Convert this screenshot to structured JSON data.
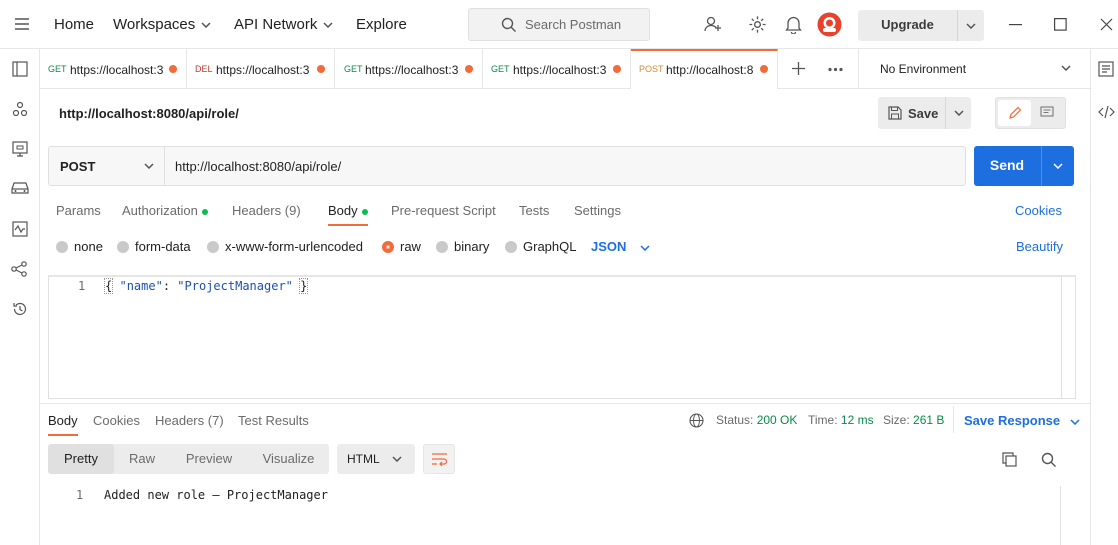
{
  "topbar": {
    "home": "Home",
    "workspaces": "Workspaces",
    "api_network": "API Network",
    "explore": "Explore",
    "search_placeholder": "Search Postman",
    "upgrade": "Upgrade"
  },
  "tabs": [
    {
      "method": "GET",
      "url": "https://localhost:3"
    },
    {
      "method": "DEL",
      "url": "https://localhost:3"
    },
    {
      "method": "GET",
      "url": "https://localhost:3"
    },
    {
      "method": "GET",
      "url": "https://localhost:3"
    },
    {
      "method": "POST",
      "url": "http://localhost:8"
    }
  ],
  "environment": "No Environment",
  "request": {
    "title": "http://localhost:8080/api/role/",
    "save_label": "Save",
    "method": "POST",
    "url": "http://localhost:8080/api/role/",
    "send_label": "Send"
  },
  "request_tabs": {
    "params": "Params",
    "authorization": "Authorization",
    "headers": "Headers",
    "headers_count": "(9)",
    "body": "Body",
    "pre_request": "Pre-request Script",
    "tests": "Tests",
    "settings": "Settings",
    "cookies": "Cookies"
  },
  "body_types": {
    "none": "none",
    "form_data": "form-data",
    "urlencoded": "x-www-form-urlencoded",
    "raw": "raw",
    "binary": "binary",
    "graphql": "GraphQL",
    "format": "JSON",
    "beautify": "Beautify"
  },
  "editor": {
    "line_number": "1",
    "open_brace": "{",
    "key": "\"name\"",
    "colon": ":",
    "value": "\"ProjectManager\"",
    "close_brace": "}"
  },
  "response_tabs": {
    "body": "Body",
    "cookies": "Cookies",
    "headers": "Headers",
    "headers_count": "(7)",
    "test_results": "Test Results"
  },
  "response_meta": {
    "status_label": "Status:",
    "status_value": "200 OK",
    "time_label": "Time:",
    "time_value": "12 ms",
    "size_label": "Size:",
    "size_value": "261 B",
    "save_response": "Save Response"
  },
  "response_view": {
    "pretty": "Pretty",
    "raw": "Raw",
    "preview": "Preview",
    "visualize": "Visualize",
    "format": "HTML"
  },
  "response_body": {
    "line_number": "1",
    "text": "Added new role — ProjectManager"
  },
  "colors": {
    "accent": "#f26b3a",
    "send": "#1d6fe0",
    "success": "#0a8a46"
  }
}
